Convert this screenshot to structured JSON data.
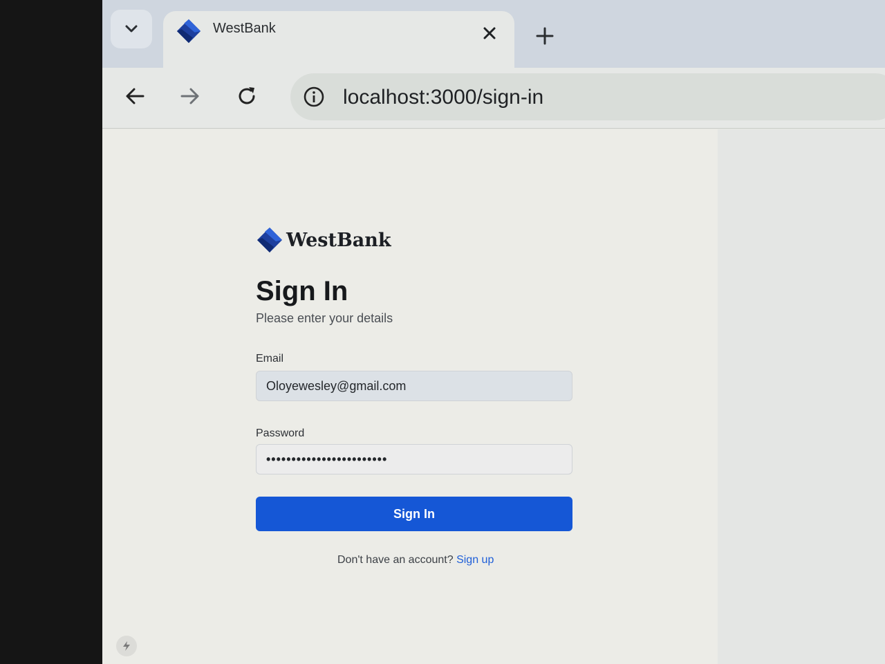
{
  "browser": {
    "tab": {
      "title": "WestBank",
      "favicon": "westbank-logo-icon"
    },
    "url": "localhost:3000/sign-in"
  },
  "brand": {
    "name": "WestBank"
  },
  "form": {
    "heading": "Sign In",
    "subheading": "Please enter your details",
    "email": {
      "label": "Email",
      "value": "Oloyewesley@gmail.com"
    },
    "password": {
      "label": "Password",
      "value": "••••••••••••••••••••••••"
    },
    "submit_label": "Sign In",
    "footer": {
      "prompt": "Don't have an account?",
      "link": "Sign up"
    }
  },
  "colors": {
    "accent": "#1557d6",
    "link": "#1f5fd8"
  }
}
